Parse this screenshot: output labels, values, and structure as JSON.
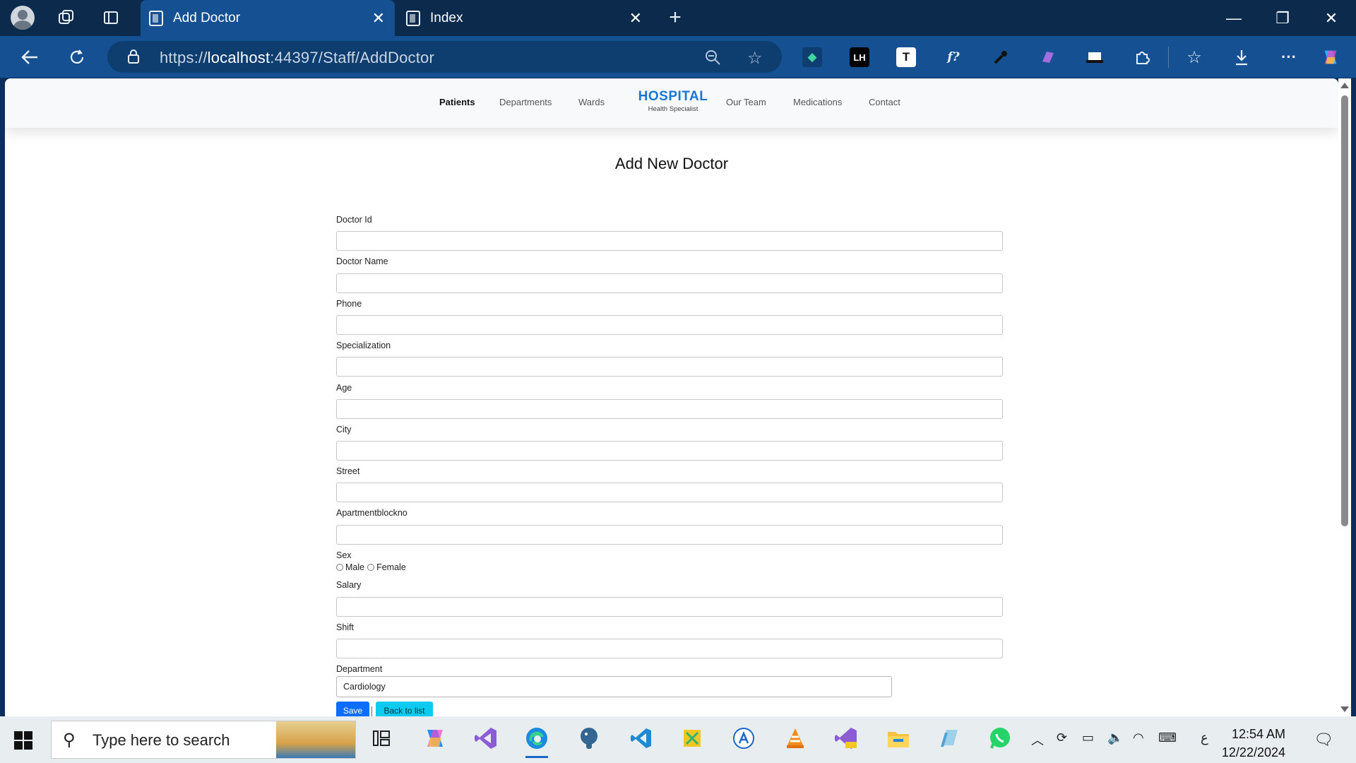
{
  "browser": {
    "tabs": [
      {
        "title": "Add Doctor",
        "active": true
      },
      {
        "title": "Index",
        "active": false
      }
    ],
    "address": {
      "scheme": "https://",
      "host": "localhost",
      "rest": ":44397/Staff/AddDoctor"
    },
    "extensions": [
      "dice-icon",
      "LH",
      "T",
      "f?",
      "eyedropper-icon",
      "copilot-icon",
      "cast-icon",
      "puzzle-icon"
    ]
  },
  "site": {
    "nav": {
      "patients": "Patients",
      "departments": "Departments",
      "wards": "Wards",
      "brand_title": "HOSPITAL",
      "brand_sub": "Health Specialist",
      "our_team": "Our Team",
      "medications": "Medications",
      "contact": "Contact"
    },
    "page_title": "Add New Doctor",
    "form": {
      "doctor_id": "Doctor Id",
      "doctor_name": "Doctor Name",
      "phone": "Phone",
      "specialization": "Specialization",
      "age": "Age",
      "city": "City",
      "street": "Street",
      "apartment": "Apartmentblockno",
      "sex": "Sex",
      "male": "Male",
      "female": "Female",
      "salary": "Salary",
      "shift": "Shift",
      "department": "Department",
      "department_value": "Cardiology",
      "save": "Save",
      "back": "Back to list"
    }
  },
  "taskbar": {
    "search_placeholder": "Type here to search",
    "time": "12:54 AM",
    "date": "12/22/2024",
    "lang": "ع"
  },
  "colors": {
    "accent": "#155192",
    "brand": "#1b76d1",
    "save_button": "#0d6efd",
    "back_button": "#0dcaf0"
  }
}
